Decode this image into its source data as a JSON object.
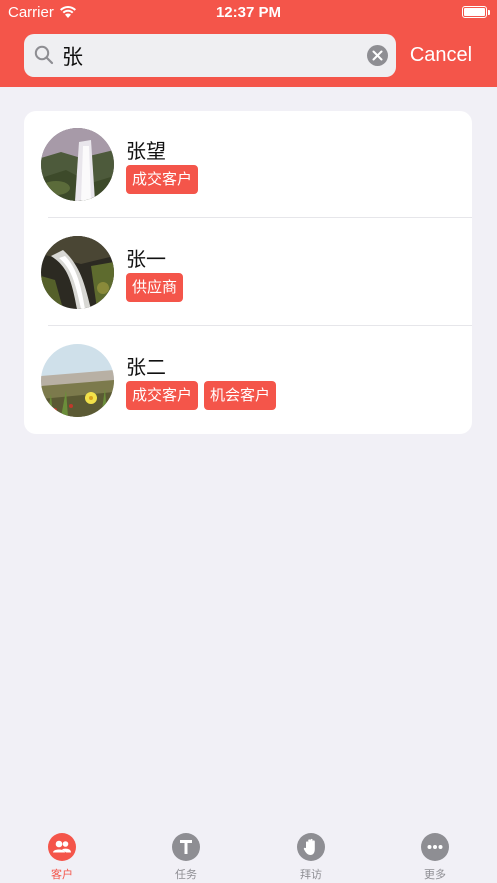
{
  "status_bar": {
    "carrier": "Carrier",
    "time": "12:37 PM"
  },
  "search": {
    "value": "张",
    "cancel_label": "Cancel"
  },
  "results": [
    {
      "name": "张望",
      "tags": [
        "成交客户"
      ],
      "avatar": "waterfall-photo"
    },
    {
      "name": "张一",
      "tags": [
        "供应商"
      ],
      "avatar": "stream-photo"
    },
    {
      "name": "张二",
      "tags": [
        "成交客户",
        "机会客户"
      ],
      "avatar": "flower-field-photo"
    }
  ],
  "tab_bar": {
    "items": [
      {
        "label": "客户",
        "icon": "people-icon",
        "active": true
      },
      {
        "label": "任务",
        "icon": "t-icon",
        "active": false
      },
      {
        "label": "拜访",
        "icon": "hand-icon",
        "active": false
      },
      {
        "label": "更多",
        "icon": "more-icon",
        "active": false
      }
    ]
  },
  "colors": {
    "accent": "#f4554a",
    "background": "#f1f0f6",
    "inactive": "#8e8e93"
  }
}
